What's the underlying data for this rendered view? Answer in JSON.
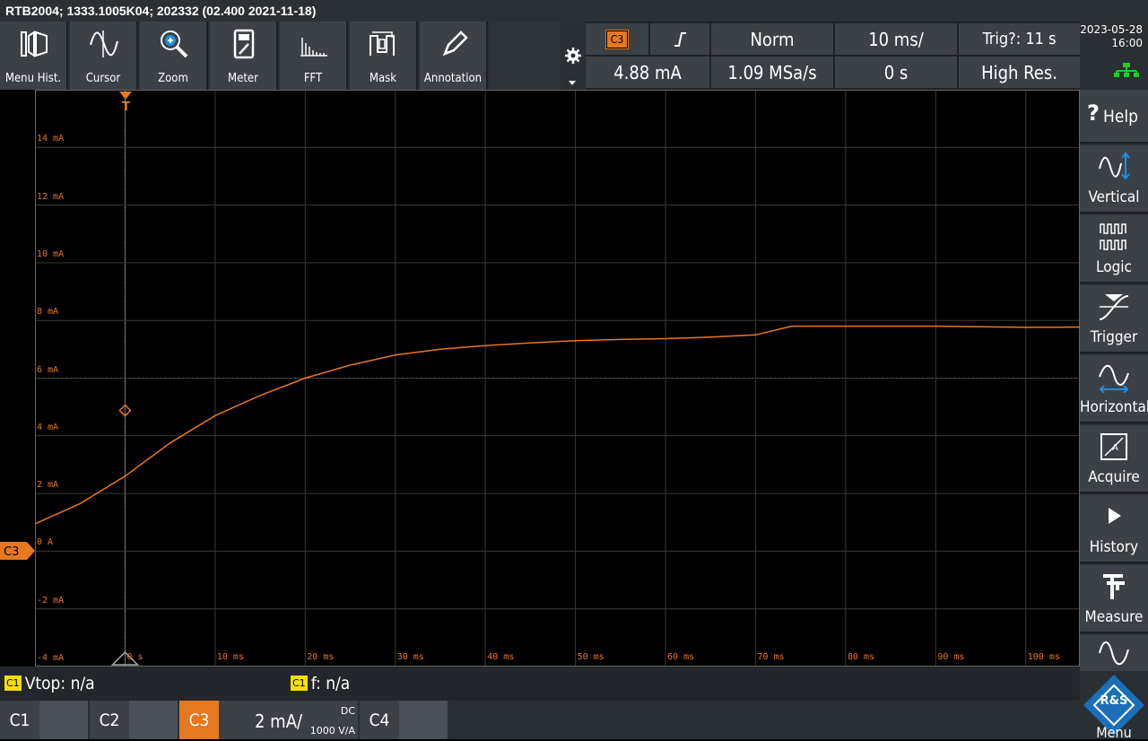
{
  "title_bar": "RTB2004; 1333.1005K04; 202332 (02.400 2021-11-18)",
  "toolbar": [
    {
      "label": "Menu Hist.",
      "icon": "menu-history-icon"
    },
    {
      "label": "Cursor",
      "icon": "cursor-icon"
    },
    {
      "label": "Zoom",
      "icon": "zoom-icon"
    },
    {
      "label": "Meter",
      "icon": "meter-icon"
    },
    {
      "label": "FFT",
      "icon": "fft-icon"
    },
    {
      "label": "Mask",
      "icon": "mask-icon"
    },
    {
      "label": "Annotation",
      "icon": "annotation-icon"
    }
  ],
  "info": {
    "trigger_source": "C3",
    "trigger_level": "4.88 mA",
    "trigger_mode": "Norm",
    "sample_rate": "1.09 MSa/s",
    "time_scale": "10 ms/",
    "time_offset": "0 s",
    "trig_status": "Trig?: 11 s",
    "acq_mode": "High Res."
  },
  "clock": {
    "date": "2023-05-28",
    "time": "16:00"
  },
  "side_menu": [
    {
      "label": "Help",
      "icon": "help-icon"
    },
    {
      "label": "Vertical",
      "icon": "vertical-icon"
    },
    {
      "label": "Logic",
      "icon": "logic-icon"
    },
    {
      "label": "Trigger",
      "icon": "trigger-icon"
    },
    {
      "label": "Horizontal",
      "icon": "horizontal-icon"
    },
    {
      "label": "Acquire",
      "icon": "acquire-icon"
    },
    {
      "label": "History",
      "icon": "history-icon"
    },
    {
      "label": "Measure",
      "icon": "measure-icon"
    },
    {
      "label": "",
      "icon": "waveform-icon"
    }
  ],
  "menu_button": {
    "label": "Menu",
    "logo_text": "R&S"
  },
  "markers": {
    "trigger_marker": "T",
    "trigger_level_marker": "TL",
    "channel_marker": "C3"
  },
  "measurements": [
    {
      "chip": "C1",
      "text": "Vtop: n/a"
    },
    {
      "chip": "C1",
      "text": "f: n/a"
    }
  ],
  "channels": {
    "c1": "C1",
    "c2": "C2",
    "c3": {
      "name": "C3",
      "scale": "2 mA/",
      "coupling": "DC",
      "probe": "1000 V/A"
    },
    "c4": "C4"
  },
  "colors": {
    "channel3": "#e6781e",
    "background": "#000000",
    "panel": "#3b4147"
  },
  "chart_data": {
    "type": "line",
    "y_tick_labels": [
      "14 mA",
      "12 mA",
      "10 mA",
      "8 mA",
      "6 mA",
      "4 mA",
      "2 mA",
      "0 A",
      "-2 mA",
      "-4 mA"
    ],
    "x_tick_labels": [
      "0 s",
      "10 ms",
      "20 ms",
      "30 ms",
      "40 ms",
      "50 ms",
      "60 ms",
      "70 ms",
      "80 ms",
      "90 ms",
      "100 ms"
    ],
    "xlim": [
      -10,
      106
    ],
    "ylim": [
      -4,
      16
    ],
    "grid": true,
    "series": [
      {
        "x": [
          -10,
          -5,
          0,
          5,
          10,
          15,
          20,
          25,
          30,
          35,
          40,
          45,
          50,
          55,
          60,
          65,
          70,
          74,
          80,
          90,
          100,
          106
        ],
        "values": [
          0.95,
          1.65,
          2.6,
          3.75,
          4.7,
          5.4,
          6.0,
          6.45,
          6.8,
          7.0,
          7.13,
          7.22,
          7.3,
          7.34,
          7.37,
          7.42,
          7.5,
          7.8,
          7.8,
          7.8,
          7.76,
          7.77
        ]
      }
    ]
  }
}
